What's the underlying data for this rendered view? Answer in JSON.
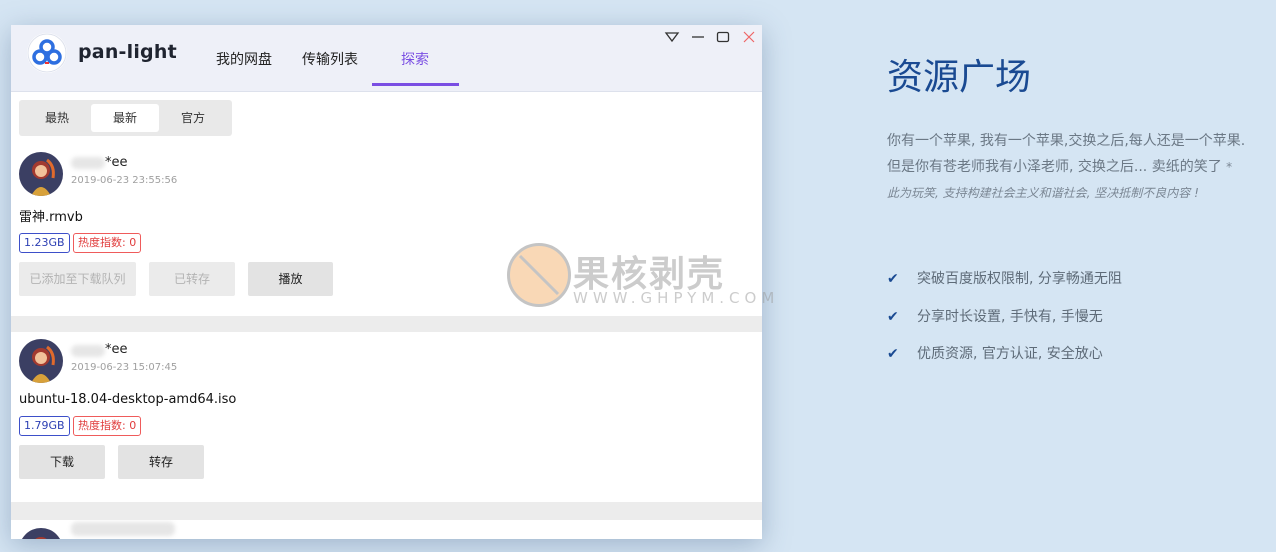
{
  "app": {
    "name": "pan-light",
    "tabs": [
      "我的网盘",
      "传输列表",
      "探索"
    ],
    "active_tab": "探索",
    "accent": "#7a4ee3"
  },
  "window_controls": [
    "dropdown-icon",
    "minimize-icon",
    "maximize-icon",
    "close-icon"
  ],
  "sort_tabs": [
    "最热",
    "最新",
    "官方"
  ],
  "active_sort": "最新",
  "items": [
    {
      "user": "*ee",
      "time": "2019-06-23 23:55:56",
      "file": "雷神.rmvb",
      "size": "1.23GB",
      "heat": "热度指数: 0",
      "buttons": [
        "已添加至下载队列",
        "已转存",
        "播放"
      ]
    },
    {
      "user": "*ee",
      "time": "2019-06-23 15:07:45",
      "file": "ubuntu-18.04-desktop-amd64.iso",
      "size": "1.79GB",
      "heat": "热度指数: 0",
      "buttons": [
        "下载",
        "转存"
      ]
    }
  ],
  "watermark": {
    "text": "果核剥壳",
    "url": "WWW.GHPYM.COM"
  },
  "hero": {
    "title": "资源广场",
    "description": "你有一个苹果, 我有一个苹果,交换之后,每人还是一个苹果. 但是你有苍老师我有小泽老师, 交换之后... 卖纸的笑了",
    "note": "* 此为玩笑, 支持构建社会主义和谐社会, 坚决抵制不良内容 !",
    "features": [
      "突破百度版权限制, 分享畅通无阻",
      "分享时长设置, 手快有, 手慢无",
      "优质资源, 官方认证, 安全放心"
    ],
    "color": "#1a4a92"
  }
}
